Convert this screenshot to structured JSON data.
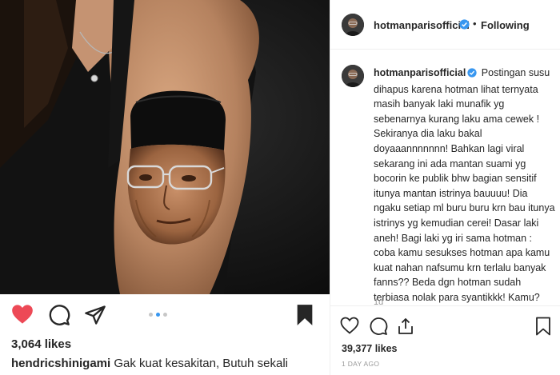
{
  "colors": {
    "accent_blue": "#3897f0",
    "like_red": "#ed4956",
    "text": "#262626",
    "muted": "#999999",
    "divider": "#efefef"
  },
  "left_post": {
    "image_alt": "tattoo-portrait-photo",
    "likes": "3,064 likes",
    "caption_user": "hendricshinigami",
    "caption_text": "Gak kuat kesakitan, Butuh sekali",
    "carousel": {
      "count": 3,
      "active": 2
    },
    "icons": [
      "heart-filled-icon",
      "comment-icon",
      "share-icon",
      "bookmark-filled-icon"
    ]
  },
  "right_panel": {
    "header": {
      "username": "hotmanparisofficial",
      "separator": "•",
      "follow_state": "Following"
    },
    "caption": {
      "username": "hotmanparisofficial",
      "text": "Postingan susu dihapus karena hotman lihat ternyata masih banyak laki munafik yg sebenarnya kurang laku ama cewek ! Sekiranya dia laku bakal doyaaannnnnnn! Bahkan lagi viral sekarang ini ada mantan suami yg bocorin ke publik bhw bagian sensitif itunya mantan istrinya bauuuu! Dia ngaku setiap ml buru buru krn bau itunya istrinys yg kemudian cerei! Dasar laki aneh! Bagi laki yg iri sama hotman : coba kamu sesukses hotman apa kamu kuat nahan nafsumu krn terlalu banyak fanns?? Beda dgn hotman sudah terbiasa nolak para syantikkk! Kamu? Mana laku dgn kijang cicilanmu!!!",
      "time_ago": "1d"
    },
    "likes": "39,377 likes",
    "date": "1 DAY AGO",
    "icons": [
      "heart-outline-icon",
      "comment-icon",
      "upload-icon",
      "bookmark-outline-icon"
    ]
  }
}
